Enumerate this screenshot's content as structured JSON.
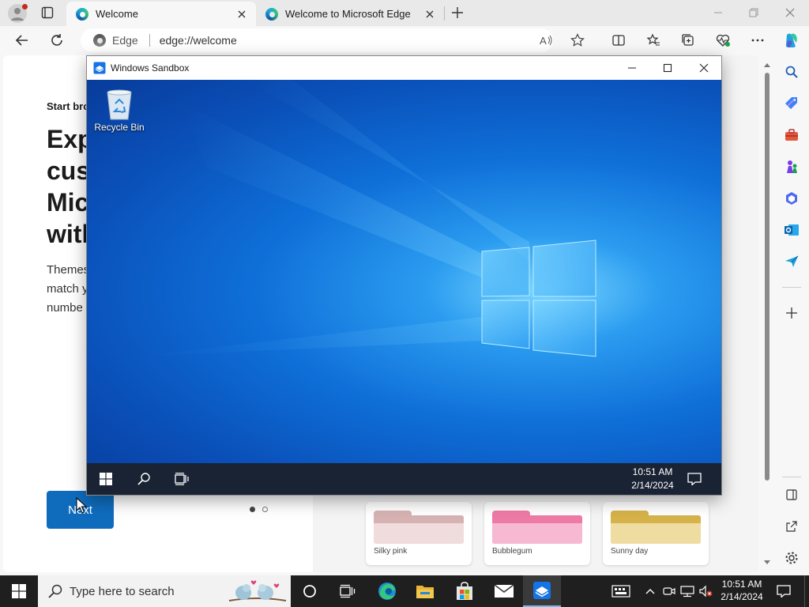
{
  "browser": {
    "tabs": [
      {
        "label": "Welcome",
        "active": true
      },
      {
        "label": "Welcome to Microsoft Edge",
        "active": false
      }
    ],
    "address": {
      "site_label": "Edge",
      "url": "edge://welcome"
    }
  },
  "page": {
    "start_label": "Start bro",
    "headline": [
      "Exp",
      "cust",
      "Mic",
      "with"
    ],
    "body_lines": [
      "Themes",
      "match y",
      "numbe"
    ],
    "next_label": "Next",
    "theme_cards": [
      {
        "name": "Silky pink",
        "tab_color": "#d7b2b2",
        "body_color": "#f0dcdc"
      },
      {
        "name": "Bubblegum",
        "tab_color": "#ee7aa6",
        "body_color": "#f7b8d2"
      },
      {
        "name": "Sunny day",
        "tab_color": "#d6b24a",
        "body_color": "#efdca1"
      }
    ]
  },
  "sandbox": {
    "title": "Windows Sandbox",
    "desktop_icon_label": "Recycle Bin",
    "clock": {
      "time": "10:51 AM",
      "date": "2/14/2024"
    }
  },
  "taskbar": {
    "search_placeholder": "Type here to search",
    "clock": {
      "time": "10:51 AM",
      "date": "2/14/2024"
    }
  },
  "colors": {
    "accent": "#0f6cbd",
    "desktop_blue": "#0a63d6",
    "taskbar": "#1f1f1f"
  }
}
